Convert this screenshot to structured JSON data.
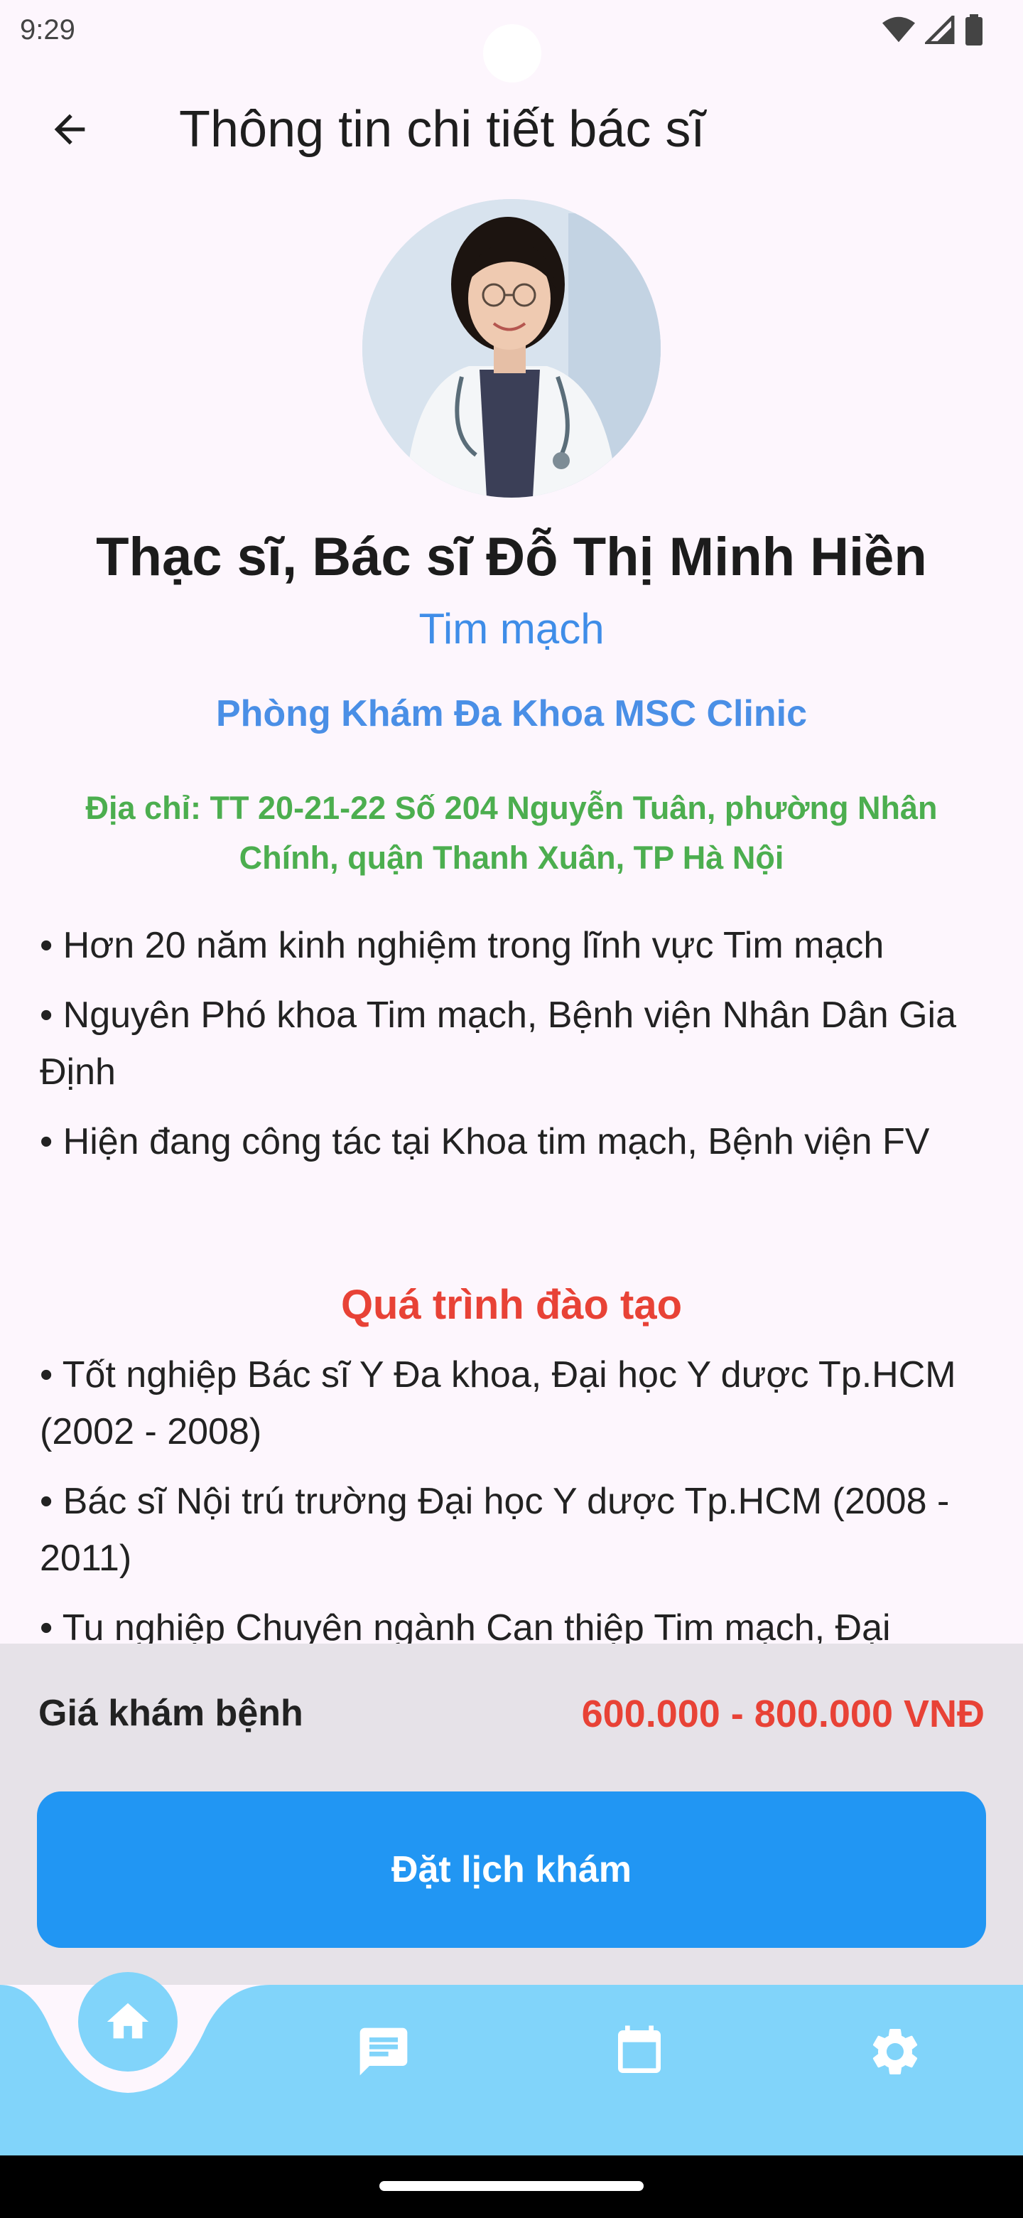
{
  "status_bar": {
    "time": "9:29",
    "icons": [
      "wifi-icon",
      "signal-icon",
      "battery-icon"
    ]
  },
  "app_bar": {
    "title": "Thông tin chi tiết bác sĩ",
    "back_icon": "arrow-back-icon"
  },
  "doctor": {
    "name": "Thạc sĩ, Bác sĩ Đỗ Thị Minh Hiền",
    "specialty": "Tim mạch",
    "clinic": "Phòng Khám Đa Khoa MSC Clinic",
    "address": "Địa chỉ:  TT 20-21-22 Số 204 Nguyễn Tuân, phường Nhân Chính, quận Thanh Xuân, TP Hà Nội"
  },
  "experience": [
    "• Hơn 20 năm kinh nghiệm trong lĩnh vực Tim mạch",
    "• Nguyên Phó khoa Tim mạch, Bệnh viện Nhân Dân Gia Định",
    "• Hiện đang công tác tại Khoa tim mạch, Bệnh viện FV"
  ],
  "training": {
    "title": "Quá trình đào tạo",
    "items": [
      "• Tốt nghiệp Bác sĩ Y Đa khoa, Đại học Y dược Tp.HCM (2002 - 2008)",
      "• Bác sĩ Nội trú trường Đại học Y dược Tp.HCM (2008 - 2011)",
      "• Tu nghiệp Chuyên ngành Can thiệp Tim mạch, Đại"
    ]
  },
  "booking": {
    "price_label": "Giá khám bệnh",
    "price_value": "600.000 - 800.000 VNĐ",
    "button_label": "Đặt lịch khám"
  },
  "bottom_nav": {
    "items": [
      "home-icon",
      "chat-icon",
      "calendar-icon",
      "settings-icon"
    ],
    "active": "home-icon"
  },
  "colors": {
    "background": "#fdf6fd",
    "primary": "#2196f3",
    "link_blue": "#4a8fe6",
    "address_green": "#4cae4f",
    "accent_red": "#e84236",
    "nav_bg": "#81d4fa"
  }
}
